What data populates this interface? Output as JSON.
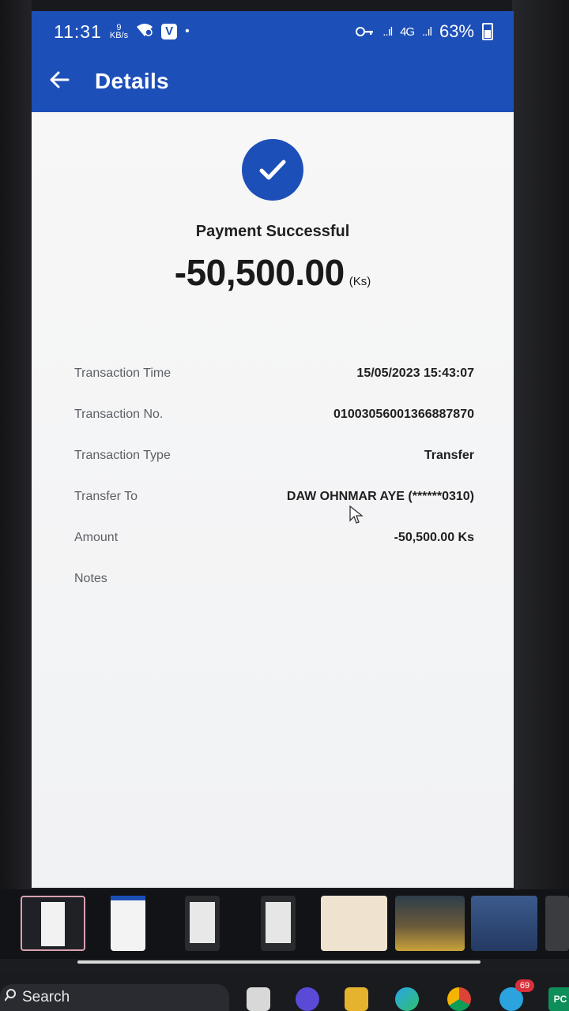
{
  "status_bar": {
    "time": "11:31",
    "net_speed_value": "9",
    "net_speed_unit": "KB/s",
    "app_badge": "V",
    "dot": "•",
    "signal_1": "..ıl",
    "network_type": "4G",
    "signal_2": "..ıl",
    "battery": "63%"
  },
  "header": {
    "title": "Details"
  },
  "summary": {
    "status_text": "Payment Successful",
    "amount": "-50,500.00",
    "currency": "(Ks)"
  },
  "details": [
    {
      "label": "Transaction Time",
      "value": "15/05/2023 15:43:07"
    },
    {
      "label": "Transaction No.",
      "value": "01003056001366887870"
    },
    {
      "label": "Transaction Type",
      "value": "Transfer"
    },
    {
      "label": "Transfer To",
      "value": "DAW OHNMAR AYE (******0310)"
    },
    {
      "label": "Amount",
      "value": "-50,500.00 Ks"
    },
    {
      "label": "Notes",
      "value": ""
    }
  ],
  "taskbar": {
    "search_label": "Search",
    "badge_count": "69",
    "pc_label": "PC"
  },
  "colors": {
    "primary": "#1d4fb8",
    "background": "#f3f4f6"
  }
}
